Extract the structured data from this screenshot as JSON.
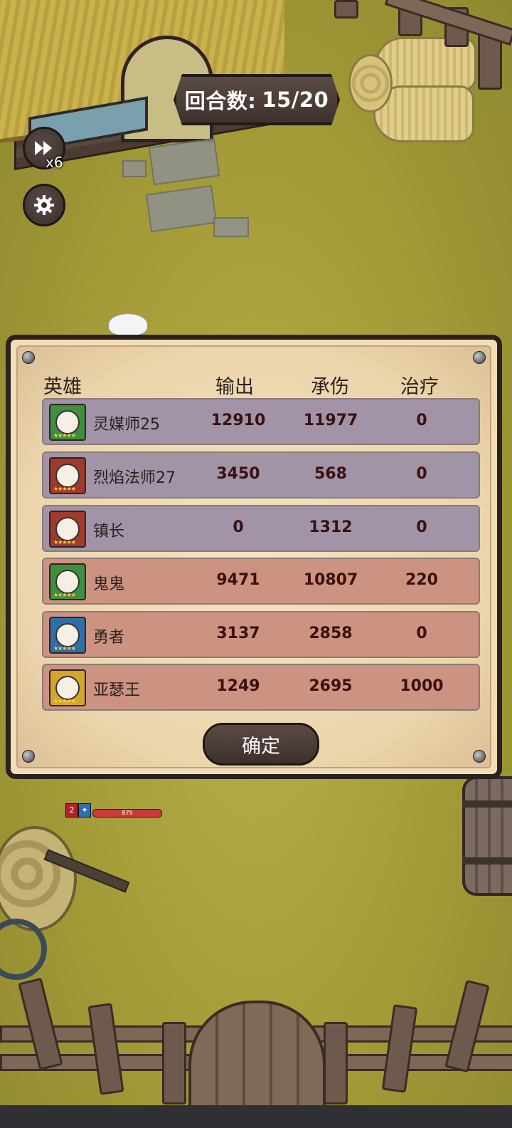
{
  "hud": {
    "round_label": "回合数:",
    "round_value": "15/20",
    "speed_multiplier": "x6"
  },
  "panel": {
    "headers": {
      "hero": "英雄",
      "damage": "输出",
      "taken": "承伤",
      "heal": "治疗"
    },
    "rows": [
      {
        "name": "灵媒师25",
        "damage": "12910",
        "taken": "11977",
        "heal": "0",
        "team": "purple",
        "frame": "#3f8f3f"
      },
      {
        "name": "烈焰法师27",
        "damage": "3450",
        "taken": "568",
        "heal": "0",
        "team": "purple",
        "frame": "#a03a2a"
      },
      {
        "name": "镇长",
        "damage": "0",
        "taken": "1312",
        "heal": "0",
        "team": "purple",
        "frame": "#a03a2a"
      },
      {
        "name": "鬼鬼",
        "damage": "9471",
        "taken": "10807",
        "heal": "220",
        "team": "red",
        "frame": "#3f8f3f"
      },
      {
        "name": "勇者",
        "damage": "3137",
        "taken": "2858",
        "heal": "0",
        "team": "red",
        "frame": "#2f6fa8"
      },
      {
        "name": "亚瑟王",
        "damage": "1249",
        "taken": "2695",
        "heal": "1000",
        "team": "red",
        "frame": "#d2a72c"
      }
    ],
    "confirm_label": "确定"
  },
  "unit": {
    "hp": "879",
    "badge": "2"
  }
}
